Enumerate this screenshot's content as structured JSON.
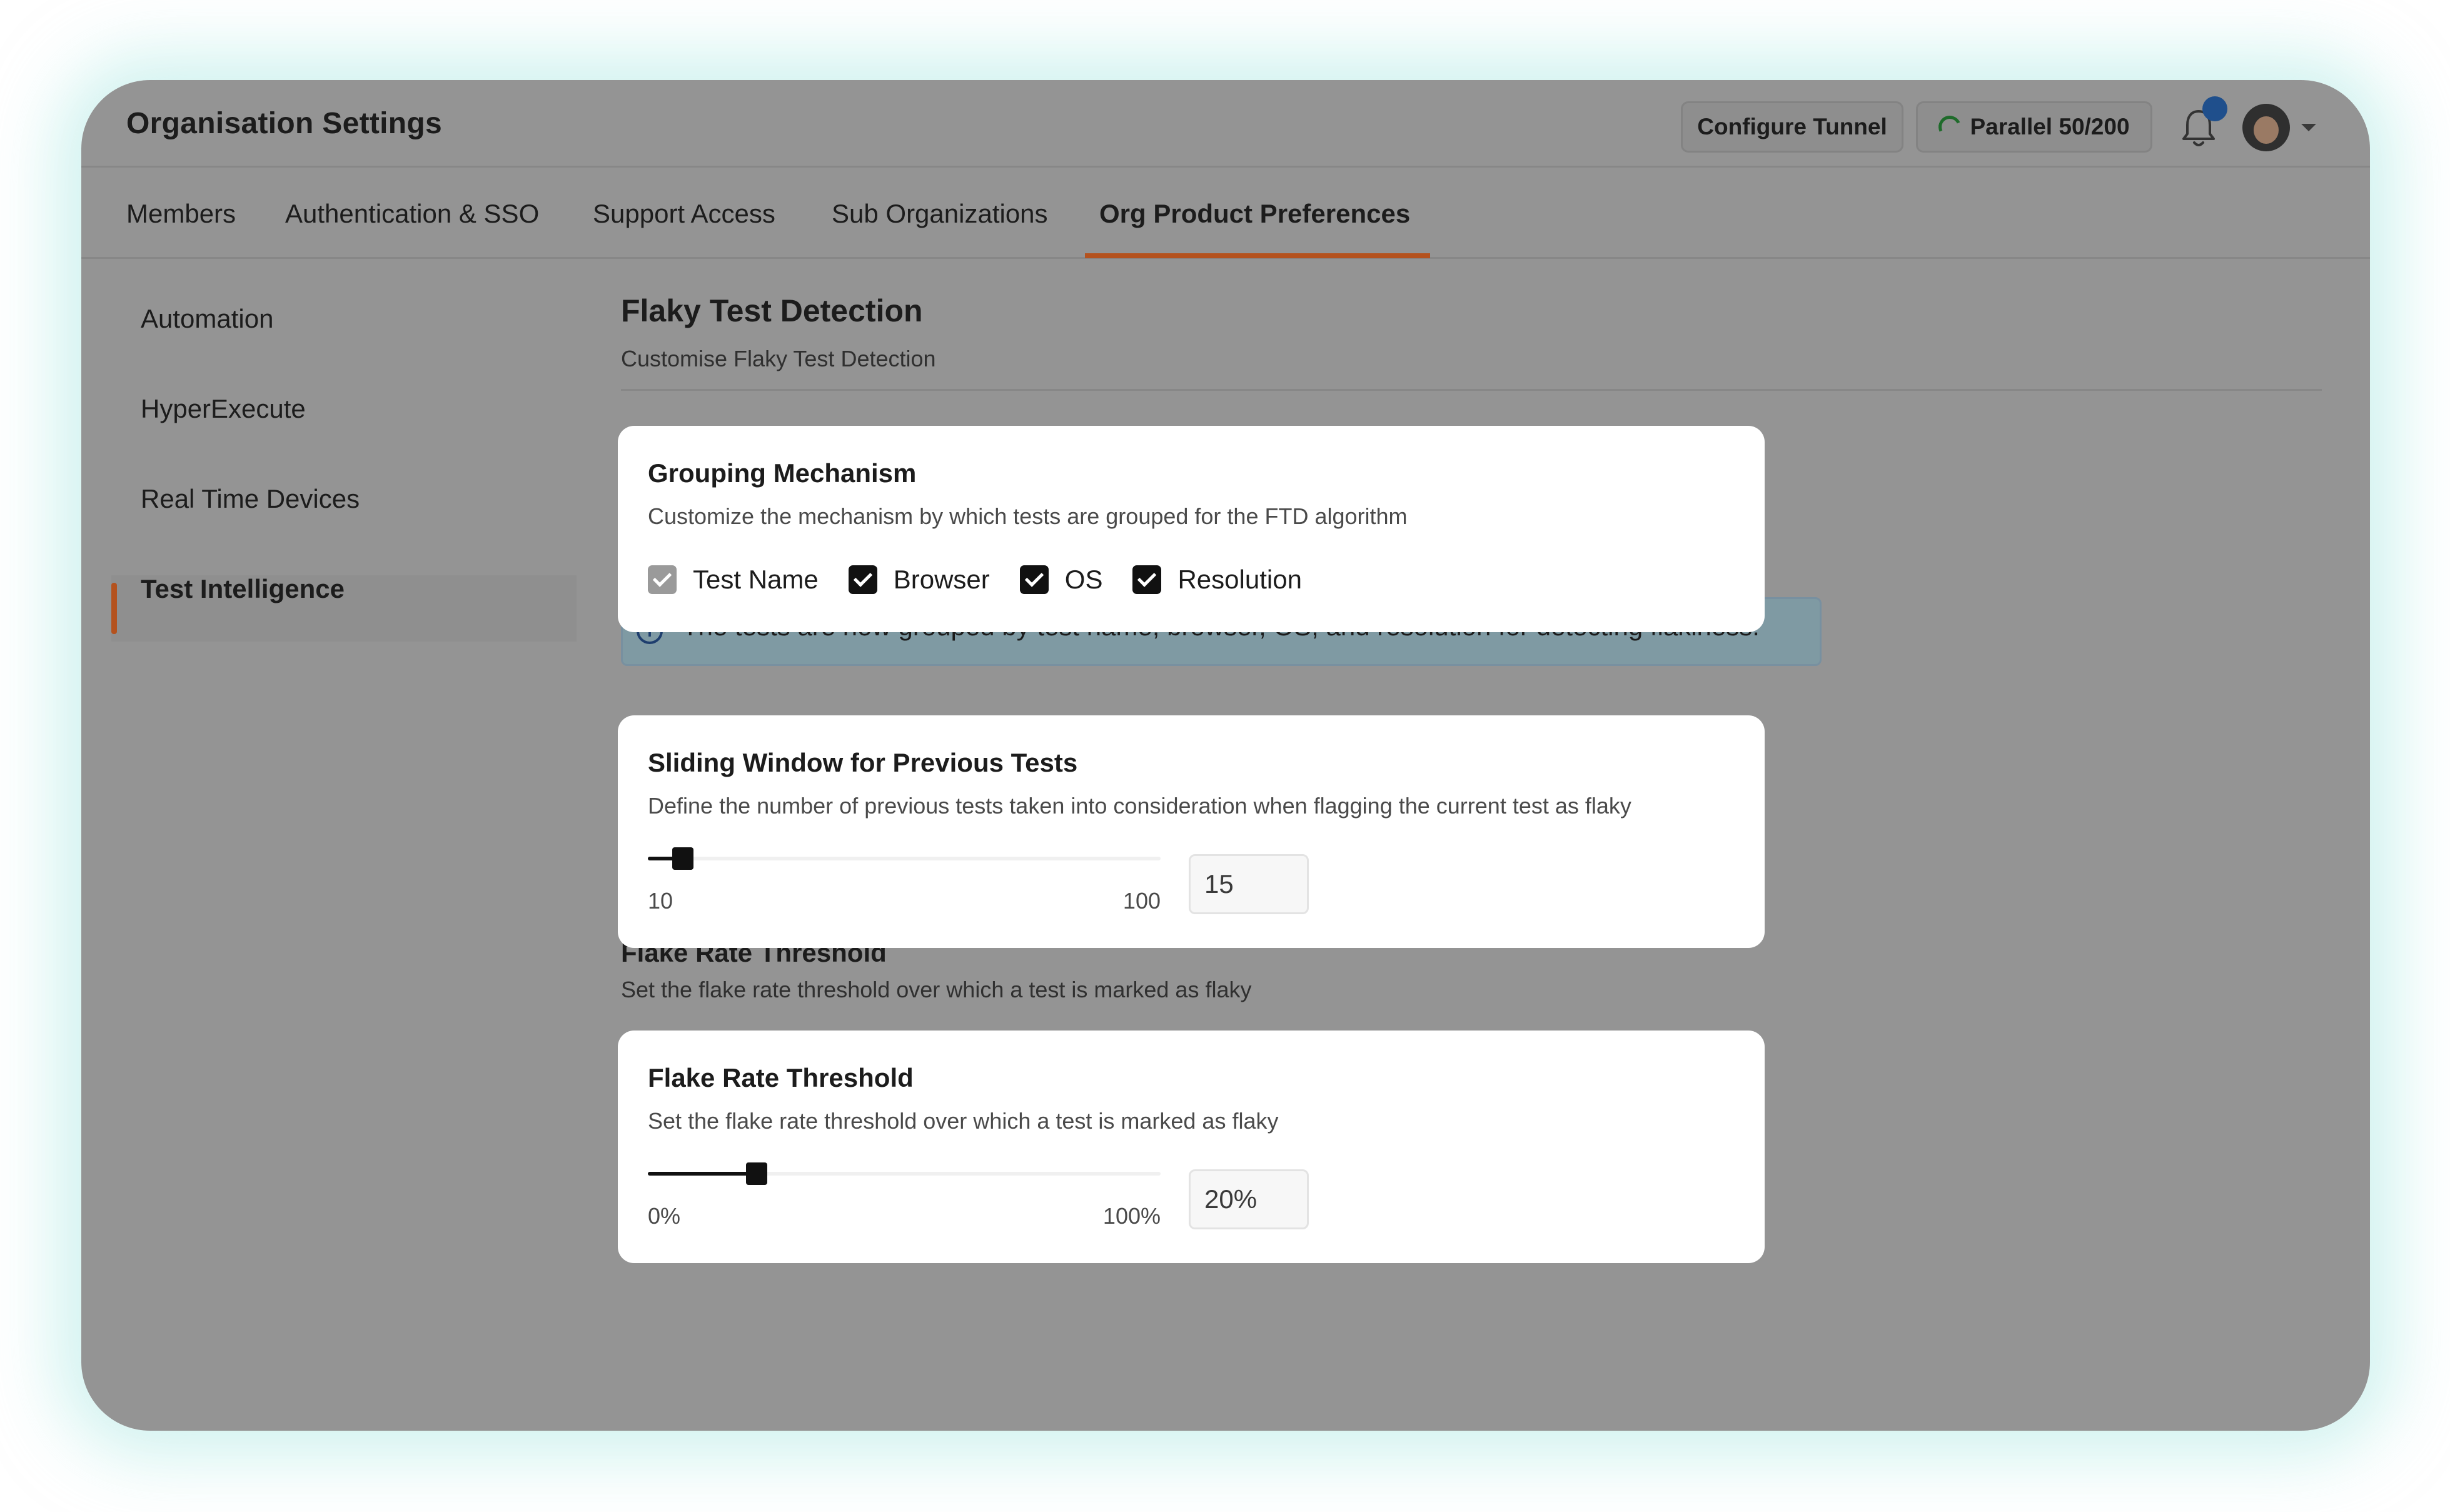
{
  "header": {
    "title": "Organisation Settings",
    "configure_tunnel": "Configure Tunnel",
    "parallel": "Parallel 50/200"
  },
  "tabs": [
    {
      "label": "Members"
    },
    {
      "label": "Authentication & SSO"
    },
    {
      "label": "Support Access"
    },
    {
      "label": "Sub Organizations"
    },
    {
      "label": "Org Product Preferences",
      "active": true
    }
  ],
  "sidebar": {
    "items": [
      {
        "label": "Automation"
      },
      {
        "label": "HyperExecute"
      },
      {
        "label": "Real Time Devices"
      },
      {
        "label": "Test Intelligence",
        "active": true
      }
    ]
  },
  "main": {
    "title": "Flaky Test Detection",
    "subtitle": "Customise Flaky Test Detection",
    "info_banner": "The tests are now grouped by test name, browser, OS, and resolution for detecting flakiness.",
    "bg_flake_title": "Flake Rate Threshold",
    "bg_flake_desc": "Set the flake rate threshold over which a test is marked as flaky"
  },
  "grouping": {
    "title": "Grouping Mechanism",
    "description": "Customize the mechanism by which tests are grouped for the FTD algorithm",
    "options": [
      {
        "label": "Test Name",
        "checked": true,
        "disabled": true
      },
      {
        "label": "Browser",
        "checked": true,
        "disabled": false
      },
      {
        "label": "OS",
        "checked": true,
        "disabled": false
      },
      {
        "label": "Resolution",
        "checked": true,
        "disabled": false
      }
    ]
  },
  "sliding_window": {
    "title": "Sliding Window for Previous Tests",
    "description": "Define the number of previous tests taken into consideration when flagging the current test as flaky",
    "min_label": "10",
    "max_label": "100",
    "min": 10,
    "max": 100,
    "value": "15",
    "slider_value": 15
  },
  "flake_rate": {
    "title": "Flake Rate Threshold",
    "description": "Set the flake rate threshold over which a test is marked as flaky",
    "min_label": "0%",
    "max_label": "100%",
    "min": 0,
    "max": 100,
    "value": "20%",
    "slider_value": 20
  },
  "colors": {
    "accent": "#b4521e",
    "overlay_bg": "#949494",
    "card_bg": "#ffffff",
    "checkbox": "#111111",
    "glow": "#aae8e2"
  },
  "icons": {
    "notification": "bell-icon",
    "loading": "spinner-icon",
    "info": "info-icon",
    "user": "avatar",
    "dropdown": "chevron-down-icon"
  }
}
